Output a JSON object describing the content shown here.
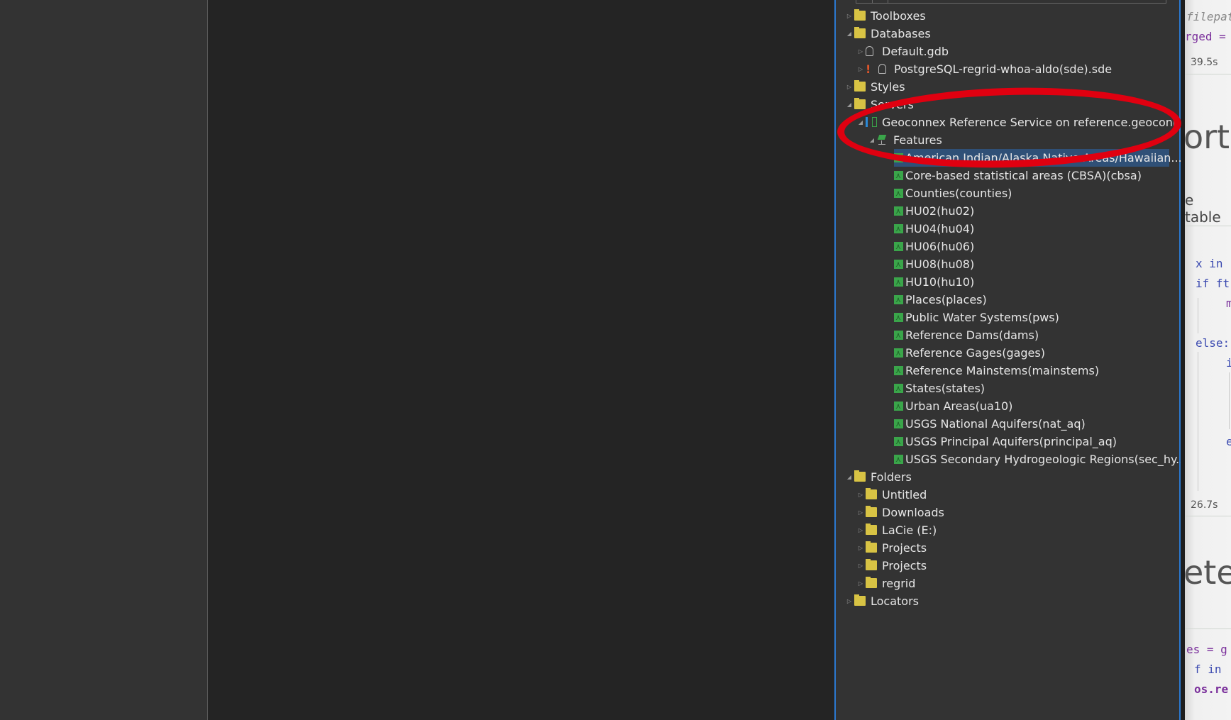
{
  "catalog": {
    "items": [
      {
        "label": "Toolboxes",
        "level": 0,
        "expander": "collapsed",
        "icon": "toolbox-folder-icon"
      },
      {
        "label": "Databases",
        "level": 0,
        "expander": "expanded",
        "icon": "database-folder-icon"
      },
      {
        "label": "Default.gdb",
        "level": 1,
        "expander": "collapsed",
        "icon": "default-geodatabase-icon"
      },
      {
        "label": "PostgreSQL-regrid-whoa-aldo(sde).sde",
        "level": 1,
        "expander": "collapsed",
        "icon": "enterprise-database-icon",
        "warning": "!"
      },
      {
        "label": "Styles",
        "level": 0,
        "expander": "collapsed",
        "icon": "styles-folder-icon"
      },
      {
        "label": "Servers",
        "level": 0,
        "expander": "expanded",
        "icon": "servers-folder-icon"
      },
      {
        "label": "Geoconnex Reference Service on reference.geoconn...",
        "level": 1,
        "expander": "expanded",
        "icon": "ogc-server-icon"
      },
      {
        "label": "Features",
        "level": 2,
        "expander": "expanded",
        "icon": "features-collection-icon"
      },
      {
        "label": "American Indian/Alaska Native Areas/Hawaiian...",
        "level": 3,
        "expander": "none",
        "icon": "feature-class-icon",
        "selected": true
      },
      {
        "label": "Core-based statistical areas (CBSA)(cbsa)",
        "level": 3,
        "expander": "none",
        "icon": "feature-class-icon"
      },
      {
        "label": "Counties(counties)",
        "level": 3,
        "expander": "none",
        "icon": "feature-class-icon"
      },
      {
        "label": "HU02(hu02)",
        "level": 3,
        "expander": "none",
        "icon": "feature-class-icon"
      },
      {
        "label": "HU04(hu04)",
        "level": 3,
        "expander": "none",
        "icon": "feature-class-icon"
      },
      {
        "label": "HU06(hu06)",
        "level": 3,
        "expander": "none",
        "icon": "feature-class-icon"
      },
      {
        "label": "HU08(hu08)",
        "level": 3,
        "expander": "none",
        "icon": "feature-class-icon"
      },
      {
        "label": "HU10(hu10)",
        "level": 3,
        "expander": "none",
        "icon": "feature-class-icon"
      },
      {
        "label": "Places(places)",
        "level": 3,
        "expander": "none",
        "icon": "feature-class-icon"
      },
      {
        "label": "Public Water Systems(pws)",
        "level": 3,
        "expander": "none",
        "icon": "feature-class-icon"
      },
      {
        "label": "Reference Dams(dams)",
        "level": 3,
        "expander": "none",
        "icon": "feature-class-icon"
      },
      {
        "label": "Reference Gages(gages)",
        "level": 3,
        "expander": "none",
        "icon": "feature-class-icon"
      },
      {
        "label": "Reference Mainstems(mainstems)",
        "level": 3,
        "expander": "none",
        "icon": "feature-class-icon"
      },
      {
        "label": "States(states)",
        "level": 3,
        "expander": "none",
        "icon": "feature-class-icon"
      },
      {
        "label": "Urban Areas(ua10)",
        "level": 3,
        "expander": "none",
        "icon": "feature-class-icon"
      },
      {
        "label": "USGS National Aquifers(nat_aq)",
        "level": 3,
        "expander": "none",
        "icon": "feature-class-icon"
      },
      {
        "label": "USGS Principal Aquifers(principal_aq)",
        "level": 3,
        "expander": "none",
        "icon": "feature-class-icon"
      },
      {
        "label": "USGS Secondary Hydrogeologic Regions(sec_hy...",
        "level": 3,
        "expander": "none",
        "icon": "feature-class-icon"
      },
      {
        "label": "Folders",
        "level": 0,
        "expander": "expanded",
        "icon": "folders-folder-icon"
      },
      {
        "label": "Untitled",
        "level": 1,
        "expander": "collapsed",
        "icon": "home-folder-icon"
      },
      {
        "label": "Downloads",
        "level": 1,
        "expander": "collapsed",
        "icon": "folder-icon"
      },
      {
        "label": "LaCie  (E:)",
        "level": 1,
        "expander": "collapsed",
        "icon": "folder-icon"
      },
      {
        "label": "Projects",
        "level": 1,
        "expander": "collapsed",
        "icon": "folder-icon"
      },
      {
        "label": "Projects",
        "level": 1,
        "expander": "collapsed",
        "icon": "folder-icon"
      },
      {
        "label": "regrid",
        "level": 1,
        "expander": "collapsed",
        "icon": "folder-icon"
      },
      {
        "label": "Locators",
        "level": 0,
        "expander": "collapsed",
        "icon": "locators-folder-icon"
      }
    ]
  },
  "code_fragment": {
    "lines": [
      {
        "text": "filepat",
        "kind": "comment"
      },
      {
        "text": "rged =",
        "kind": "code"
      },
      {
        "text": "39.5s",
        "kind": "time"
      },
      {
        "text": "ort",
        "kind": "heading"
      },
      {
        "text": "e table",
        "kind": "markdown"
      },
      {
        "text": "x in",
        "kind": "code"
      },
      {
        "text": "if ft",
        "kind": "code"
      },
      {
        "text": "m",
        "kind": "code"
      },
      {
        "text": "else:",
        "kind": "code"
      },
      {
        "text": "i",
        "kind": "code"
      },
      {
        "text": "e",
        "kind": "code"
      },
      {
        "text": "26.7s",
        "kind": "time"
      },
      {
        "text": "ete",
        "kind": "heading"
      },
      {
        "text": "es = g",
        "kind": "code"
      },
      {
        "text": "f in",
        "kind": "code"
      },
      {
        "text": "os.re",
        "kind": "code"
      }
    ]
  },
  "annotation": {
    "shape": "red-ellipse",
    "color": "#e00010",
    "target": "Geoconnex Reference Service on reference.geoconn..."
  },
  "colors": {
    "panel_bg": "#333333",
    "selection": "#2f5077",
    "accent_border": "#2b79d0"
  }
}
